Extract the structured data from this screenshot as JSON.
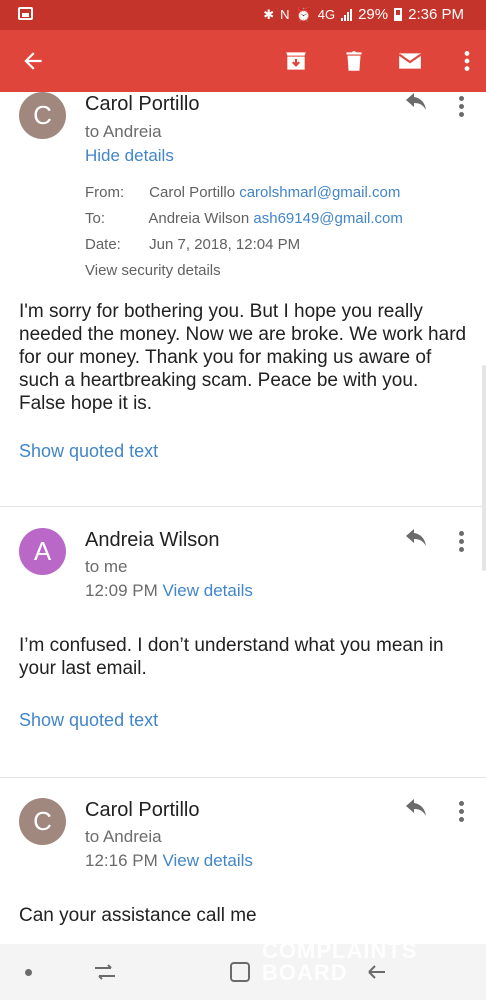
{
  "status": {
    "battery": "29%",
    "time": "2:36 PM",
    "net": "4G"
  },
  "app_bar": {
    "icons": [
      "back-arrow-icon",
      "archive-icon",
      "trash-icon",
      "mail-icon",
      "more-vert-icon"
    ]
  },
  "messages": [
    {
      "avatar": "C",
      "avatar_color": "#a1887f",
      "sender": "Carol Portillo",
      "to": "to Andreia",
      "hide_details": "Hide details",
      "details": {
        "from_label": "From:",
        "from_name": "Carol Portillo",
        "from_email": "carolshmarl@gmail.com",
        "to_label": "To:",
        "to_name": "Andreia Wilson",
        "to_email": "ash69149@gmail.com",
        "date_label": "Date:",
        "date": "Jun 7, 2018, 12:04 PM",
        "security": "View security details"
      },
      "body": "I'm sorry for bothering you. But I hope you really needed the money. Now we are broke. We work hard for our money. Thank you for making us aware of such a heartbreaking scam. Peace be with you. False hope it is.",
      "quoted": "Show quoted text"
    },
    {
      "avatar": "A",
      "avatar_color": "#ba68c8",
      "sender": "Andreia Wilson",
      "to": "to me",
      "time": "12:09 PM",
      "view_details": "View details",
      "body": "I’m confused. I don’t understand what you mean in your last email.",
      "quoted": "Show quoted text"
    },
    {
      "avatar": "C",
      "avatar_color": "#a1887f",
      "sender": "Carol Portillo",
      "to": "to Andreia",
      "time": "12:16 PM",
      "view_details": "View details",
      "body": "Can your assistance call me"
    }
  ],
  "watermark": {
    "line1": "COMPLAINTS",
    "line2": "BOARD"
  }
}
